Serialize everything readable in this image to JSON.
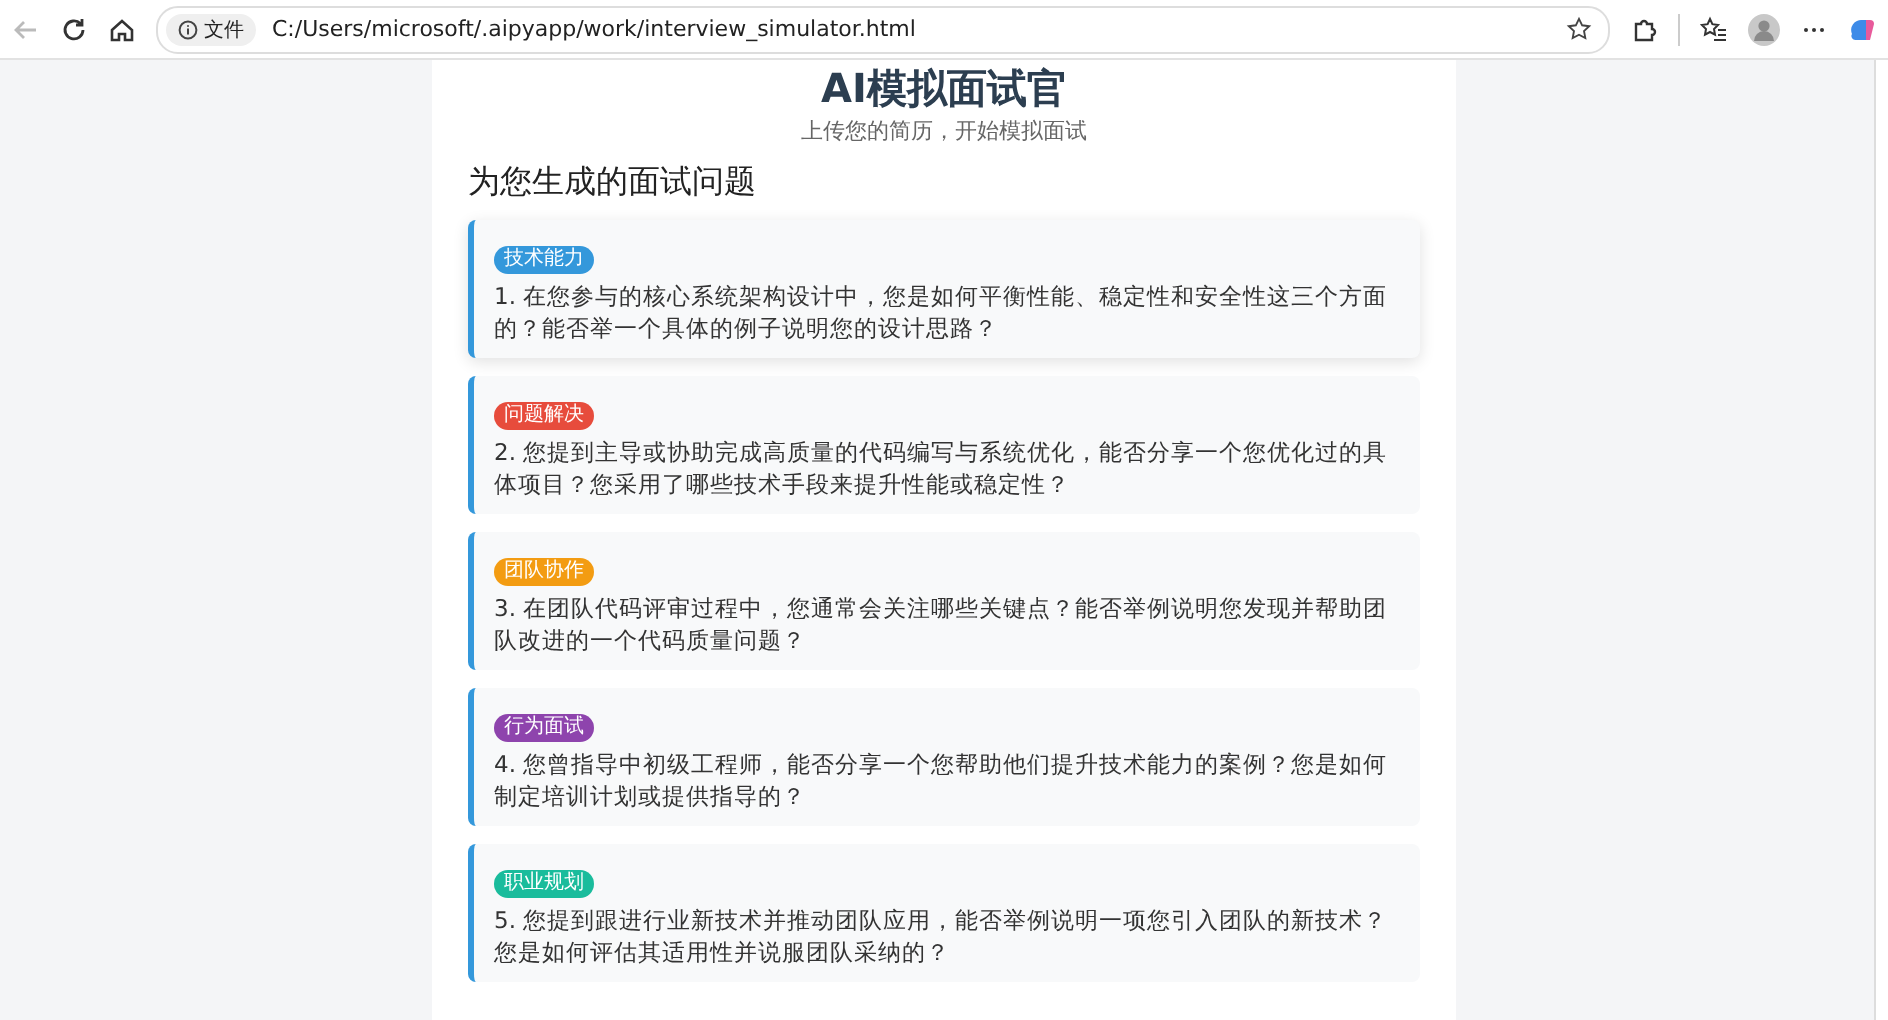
{
  "browser": {
    "back_disabled": true,
    "site_label": "文件",
    "url": "C:/Users/microsoft/.aipyapp/work/interview_simulator.html"
  },
  "header": {
    "title": "AI模拟面试官",
    "subtitle": "上传您的简历，开始模拟面试"
  },
  "section_title": "为您生成的面试问题",
  "questions": [
    {
      "tag": "技术能力",
      "color": "#3498db",
      "hovered": true,
      "text": "1. 在您参与的核心系统架构设计中，您是如何平衡性能、稳定性和安全性这三个方面的？能否举一个具体的例子说明您的设计思路？"
    },
    {
      "tag": "问题解决",
      "color": "#e74c3c",
      "hovered": false,
      "text": "2. 您提到主导或协助完成高质量的代码编写与系统优化，能否分享一个您优化过的具体项目？您采用了哪些技术手段来提升性能或稳定性？"
    },
    {
      "tag": "团队协作",
      "color": "#f39c12",
      "hovered": false,
      "text": "3. 在团队代码评审过程中，您通常会关注哪些关键点？能否举例说明您发现并帮助团队改进的一个代码质量问题？"
    },
    {
      "tag": "行为面试",
      "color": "#8e44ad",
      "hovered": false,
      "text": "4. 您曾指导中初级工程师，能否分享一个您帮助他们提升技术能力的案例？您是如何制定培训计划或提供指导的？"
    },
    {
      "tag": "职业规划",
      "color": "#1abc9c",
      "hovered": false,
      "text": "5. 您提到跟进行业新技术并推动团队应用，能否举例说明一项您引入团队的新技术？您是如何评估其适用性并说服团队采纳的？"
    }
  ]
}
